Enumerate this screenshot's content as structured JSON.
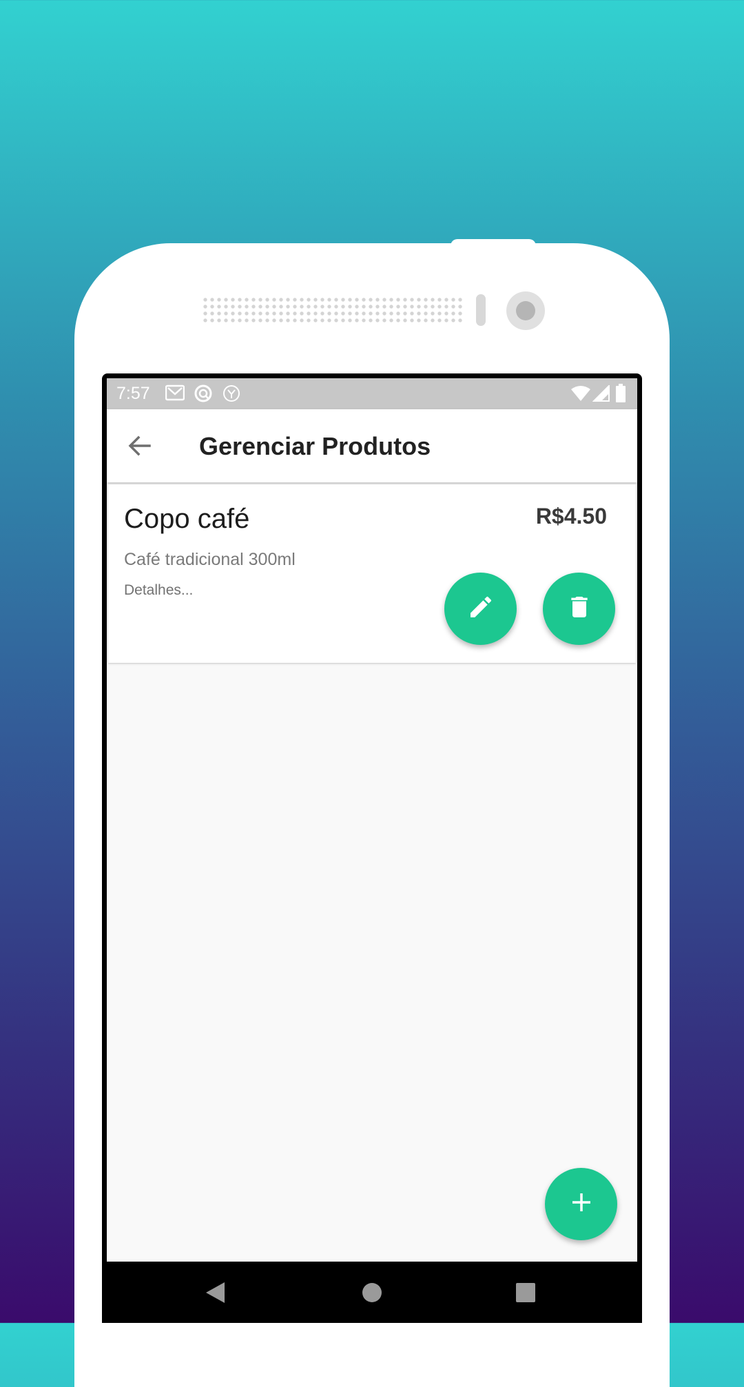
{
  "status_bar": {
    "time": "7:57",
    "left_icons": [
      "gmail-icon",
      "sync-icon",
      "app-icon"
    ],
    "right_icons": [
      "wifi-icon",
      "signal-icon",
      "battery-icon"
    ]
  },
  "app_bar": {
    "back_icon": "arrow-left-icon",
    "title": "Gerenciar Produtos"
  },
  "products": [
    {
      "name": "Copo café",
      "price": "R$4.50",
      "description": "Café tradicional 300ml",
      "details_link": "Detalhes...",
      "actions": [
        "pencil-icon",
        "trash-icon"
      ]
    }
  ],
  "fab": {
    "icon": "plus-icon"
  },
  "nav_bar": {
    "buttons": [
      "back-triangle-icon",
      "home-circle-icon",
      "recents-square-icon"
    ]
  },
  "colors": {
    "accent": "#1cc790",
    "gradient_top": "#32d1d0",
    "gradient_bottom": "#3a0b6c",
    "status_bar": "#c7c7c7"
  }
}
